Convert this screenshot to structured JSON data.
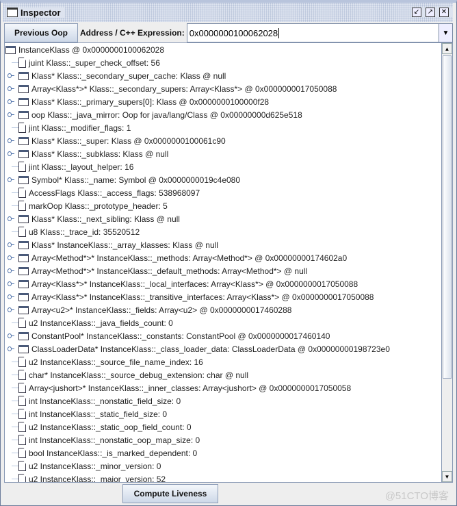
{
  "window": {
    "title": "Inspector",
    "buttons": [
      "minimize",
      "maximize",
      "close"
    ]
  },
  "toolbar": {
    "previous_label": "Previous Oop",
    "address_label": "Address / C++ Expression:",
    "address_value": "0x0000000100062028"
  },
  "tree": {
    "rows": [
      {
        "type": "root",
        "text": "InstanceKlass @ 0x0000000100062028"
      },
      {
        "type": "leaf",
        "text": "juint Klass::_super_check_offset: 56"
      },
      {
        "type": "node",
        "text": "Klass* Klass::_secondary_super_cache: Klass @ null"
      },
      {
        "type": "node",
        "text": "Array<Klass*>* Klass::_secondary_supers: Array<Klass*> @ 0x0000000017050088"
      },
      {
        "type": "node",
        "text": "Klass* Klass::_primary_supers[0]: Klass @ 0x0000000100000f28"
      },
      {
        "type": "node",
        "text": "oop Klass::_java_mirror: Oop for java/lang/Class @ 0x00000000d625e518"
      },
      {
        "type": "leaf",
        "text": "jint Klass::_modifier_flags: 1"
      },
      {
        "type": "node",
        "text": "Klass* Klass::_super: Klass @ 0x0000000100061c90"
      },
      {
        "type": "node",
        "text": "Klass* Klass::_subklass: Klass @ null"
      },
      {
        "type": "leaf",
        "text": "jint Klass::_layout_helper: 16"
      },
      {
        "type": "node",
        "text": "Symbol* Klass::_name: Symbol @ 0x0000000019c4e080"
      },
      {
        "type": "leaf",
        "text": "AccessFlags Klass::_access_flags: 538968097"
      },
      {
        "type": "leaf",
        "text": "markOop Klass::_prototype_header: 5"
      },
      {
        "type": "node",
        "text": "Klass* Klass::_next_sibling: Klass @ null"
      },
      {
        "type": "leaf",
        "text": "u8 Klass::_trace_id: 35520512"
      },
      {
        "type": "node",
        "text": "Klass* InstanceKlass::_array_klasses: Klass @ null"
      },
      {
        "type": "node",
        "text": "Array<Method*>* InstanceKlass::_methods: Array<Method*> @ 0x00000000174602a0"
      },
      {
        "type": "node",
        "text": "Array<Method*>* InstanceKlass::_default_methods: Array<Method*> @ null"
      },
      {
        "type": "node",
        "text": "Array<Klass*>* InstanceKlass::_local_interfaces: Array<Klass*> @ 0x0000000017050088"
      },
      {
        "type": "node",
        "text": "Array<Klass*>* InstanceKlass::_transitive_interfaces: Array<Klass*> @ 0x0000000017050088"
      },
      {
        "type": "node",
        "text": "Array<u2>* InstanceKlass::_fields: Array<u2> @ 0x0000000017460288"
      },
      {
        "type": "leaf",
        "text": "u2 InstanceKlass::_java_fields_count: 0"
      },
      {
        "type": "node",
        "text": "ConstantPool* InstanceKlass::_constants: ConstantPool @ 0x0000000017460140"
      },
      {
        "type": "node",
        "text": "ClassLoaderData* InstanceKlass::_class_loader_data: ClassLoaderData @ 0x00000000198723e0"
      },
      {
        "type": "leaf",
        "text": "u2 InstanceKlass::_source_file_name_index: 16"
      },
      {
        "type": "leaf",
        "text": "char* InstanceKlass::_source_debug_extension: char @ null"
      },
      {
        "type": "leaf",
        "text": "Array<jushort>* InstanceKlass::_inner_classes: Array<jushort> @ 0x0000000017050058"
      },
      {
        "type": "leaf",
        "text": "int InstanceKlass::_nonstatic_field_size: 0"
      },
      {
        "type": "leaf",
        "text": "int InstanceKlass::_static_field_size: 0"
      },
      {
        "type": "leaf",
        "text": "u2 InstanceKlass::_static_oop_field_count: 0"
      },
      {
        "type": "leaf",
        "text": "int InstanceKlass::_nonstatic_oop_map_size: 0"
      },
      {
        "type": "leaf",
        "text": "bool InstanceKlass::_is_marked_dependent: 0"
      },
      {
        "type": "leaf",
        "text": "u2 InstanceKlass::_minor_version: 0"
      },
      {
        "type": "leaf",
        "text": "u2 InstanceKlass::_major_version: 52"
      }
    ]
  },
  "bottom": {
    "liveness_label": "Compute Liveness",
    "watermark": "@51CTO博客"
  }
}
